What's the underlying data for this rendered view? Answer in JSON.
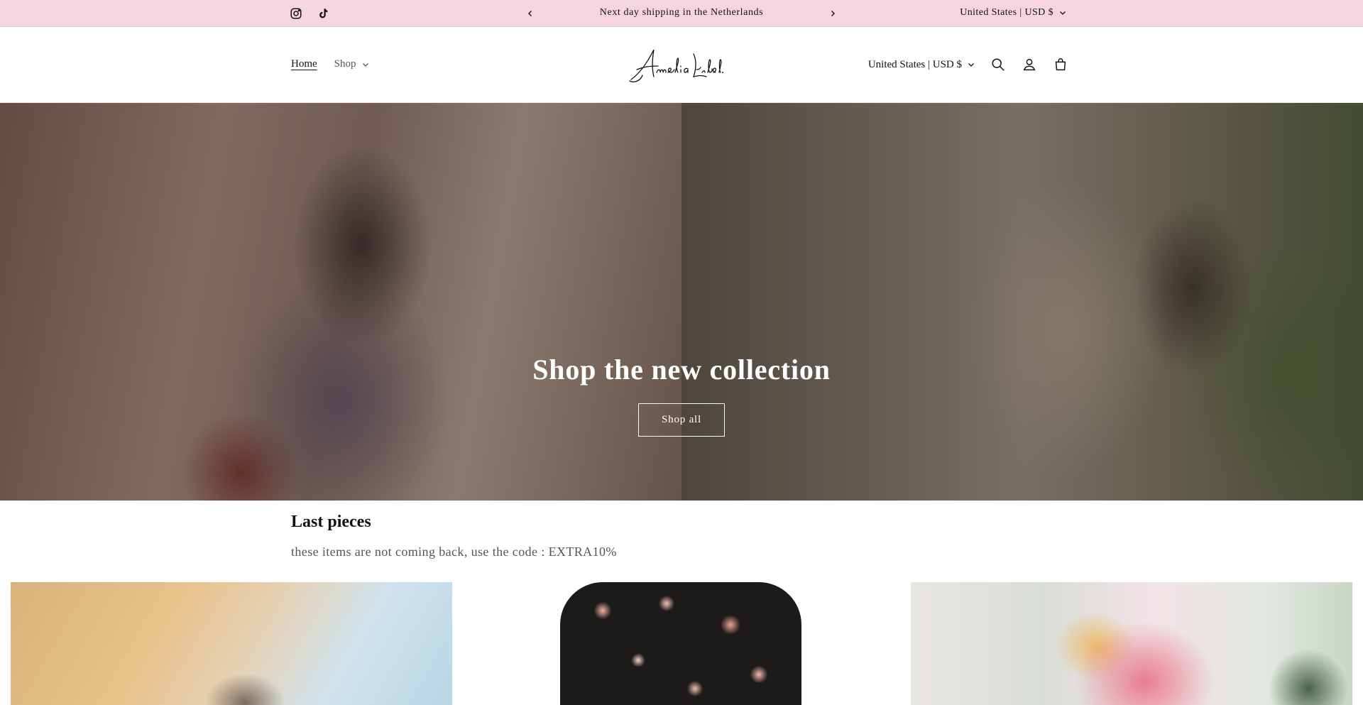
{
  "announcement": {
    "social": [
      "instagram-icon",
      "tiktok-icon"
    ],
    "message": "Next day shipping in the Netherlands",
    "locale": "United States | USD $"
  },
  "header": {
    "nav": [
      {
        "label": "Home",
        "active": true
      },
      {
        "label": "Shop",
        "has_dropdown": true
      }
    ],
    "logo_text": "Amelia Label.",
    "locale": "United States | USD $",
    "icons": [
      "search-icon",
      "account-icon",
      "cart-icon"
    ]
  },
  "hero": {
    "title": "Shop the new collection",
    "button": "Shop all"
  },
  "collection": {
    "title": "Last pieces",
    "subtitle": "these items are not coming back, use the code : EXTRA10%"
  },
  "colors": {
    "announcement_bg": "#f6d6de",
    "text": "#121212",
    "muted": "#555555"
  }
}
